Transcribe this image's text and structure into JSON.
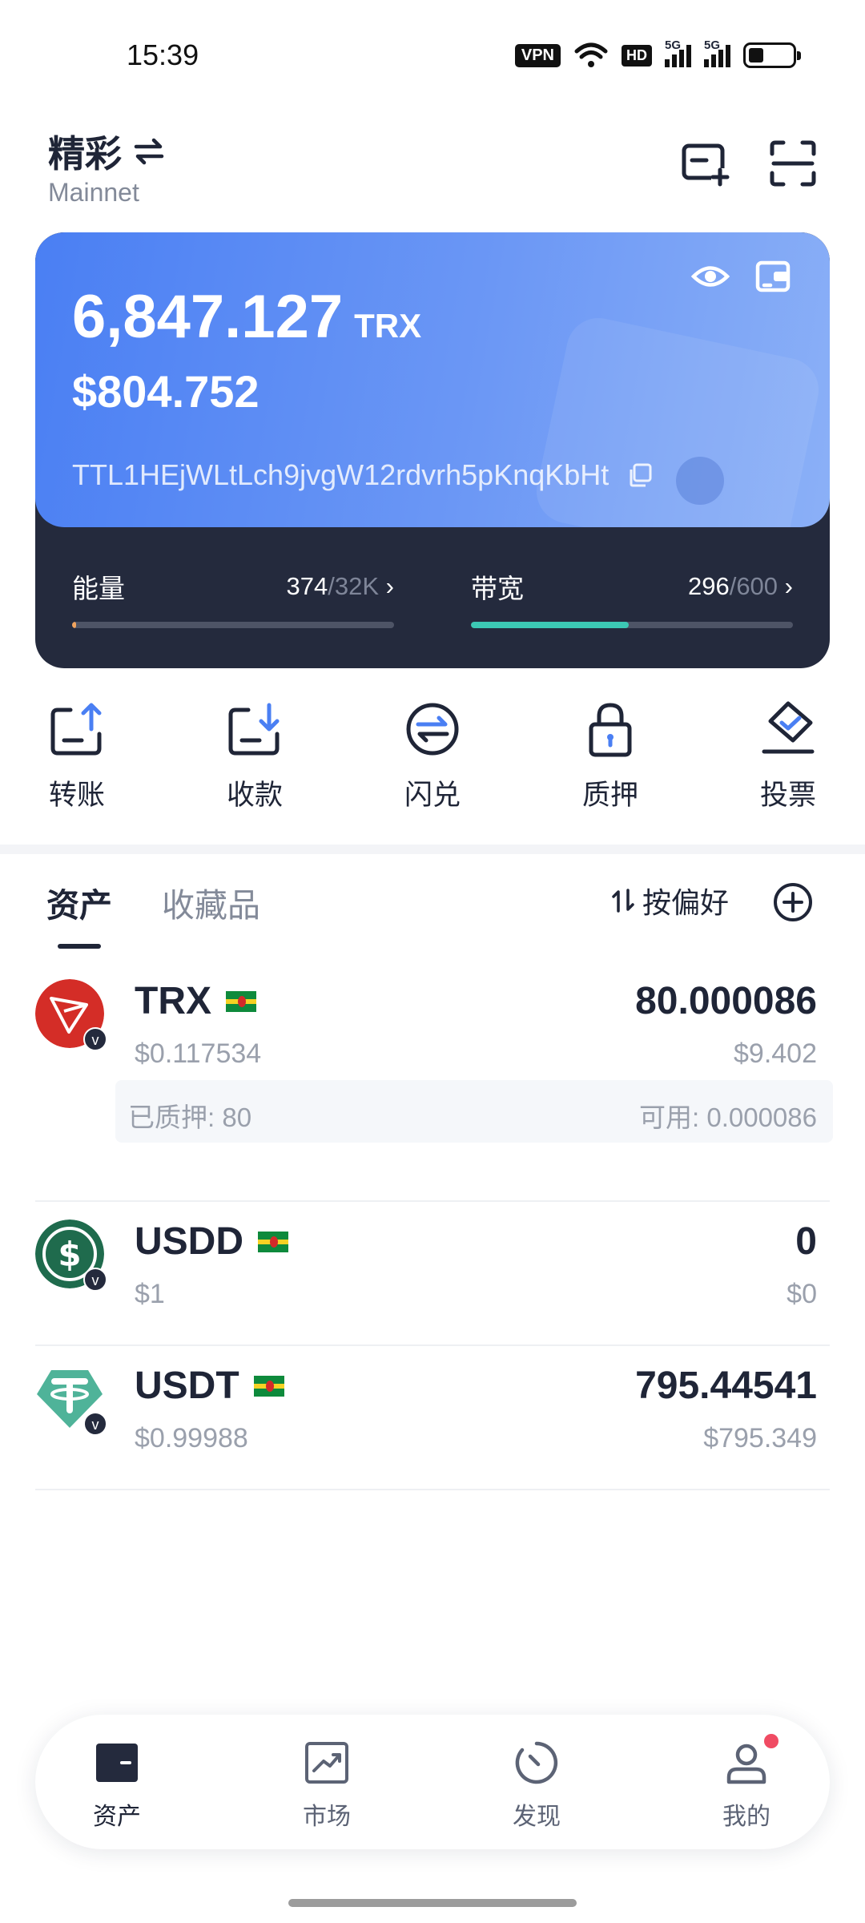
{
  "status_bar": {
    "time": "15:39",
    "vpn": "VPN",
    "hd": "HD",
    "network_tag_1": "5G",
    "network_tag_2": "5G"
  },
  "header": {
    "wallet_name": "精彩",
    "switch_icon": "swap-arrows-icon",
    "network": "Mainnet"
  },
  "card": {
    "balance": "6,847.127",
    "unit": "TRX",
    "usd": "$804.752",
    "address": "TTL1HEjWLtLch9jvgW12rdvrh5pKnqKbHt",
    "energy": {
      "label": "能量",
      "used": "374",
      "total": "/32K",
      "level": 0.012,
      "color": "#f0a35e"
    },
    "bandwidth": {
      "label": "带宽",
      "used": "296",
      "total": "/600",
      "level": 0.49,
      "color": "#3cc8b4"
    }
  },
  "actions": [
    {
      "label": "转账",
      "icon": "transfer-out-icon"
    },
    {
      "label": "收款",
      "icon": "receive-icon"
    },
    {
      "label": "闪兑",
      "icon": "swap-icon"
    },
    {
      "label": "质押",
      "icon": "lock-icon"
    },
    {
      "label": "投票",
      "icon": "vote-icon"
    }
  ],
  "tabs": {
    "assets": "资产",
    "collectibles": "收藏品",
    "sort": "按偏好"
  },
  "assets": [
    {
      "symbol": "TRX",
      "price": "$0.117534",
      "amount": "80.000086",
      "value": "$9.402",
      "staked": "已质押: 80",
      "available": "可用: 0.000086",
      "color": "#d42d27"
    },
    {
      "symbol": "USDD",
      "price": "$1",
      "amount": "0",
      "value": "$0",
      "color": "#1f6b4d"
    },
    {
      "symbol": "USDT",
      "price": "$0.99988",
      "amount": "795.44541",
      "value": "$795.349",
      "color": "#4fb399"
    }
  ],
  "nav": [
    {
      "label": "资产",
      "icon": "wallet-icon"
    },
    {
      "label": "市场",
      "icon": "market-chart-icon"
    },
    {
      "label": "发现",
      "icon": "discover-icon"
    },
    {
      "label": "我的",
      "icon": "profile-icon"
    }
  ],
  "colors": {
    "primary": "#4a7ff3",
    "dark": "#242a3d",
    "notification": "#f04b63"
  }
}
